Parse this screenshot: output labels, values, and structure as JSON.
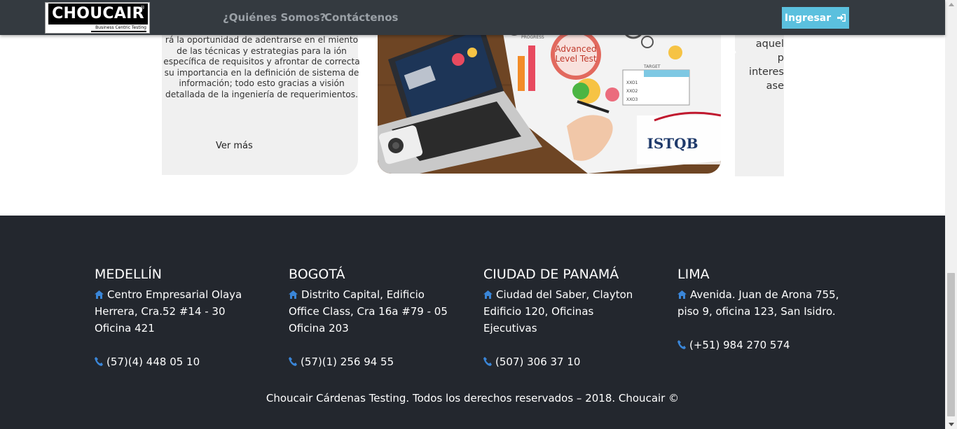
{
  "navbar": {
    "logo_text": "CHOUCAIR",
    "logo_reg": "®",
    "logo_sub": "Business Centric Testing",
    "links": [
      "¿Quiénes Somos?",
      "Contáctenos"
    ],
    "login_label": "Ingresar"
  },
  "carousel": {
    "left_text": "rá la oportunidad de adentrarse en el miento de las técnicas y estrategias para la ión específica de requisitos y afrontar de correcta su importancia en la definición de sistema de información; todo esto gracias a visión detallada de la ingeniería de requerimientos.",
    "left_more": "Ver más",
    "image_labels": {
      "advanced": "Advanced",
      "level": "Level Test",
      "progress": "PROGRESS",
      "target": "TARGET",
      "istqb": "ISTQB",
      "x1": "XXO1",
      "x2": "XXO2",
      "x3": "XXO3"
    },
    "right_lines": [
      "aquel",
      "p",
      "interes",
      "ase"
    ]
  },
  "footer": {
    "columns": [
      {
        "city": "MEDELLÍN",
        "address": "Centro Empresarial Olaya Herrera, Cra.52 #14 - 30 Oficina 421",
        "phone": "(57)(4) 448 05 10"
      },
      {
        "city": "BOGOTÁ",
        "address": "Distrito Capital, Edificio Office Class, Cra 16a #79 - 05 Oficina 203",
        "phone": "(57)(1) 256 94 55"
      },
      {
        "city": "CIUDAD DE PANAMÁ",
        "address": "Ciudad del Saber, Clayton Edificio 120, Oficinas Ejecutivas",
        "phone": "(507) 306 37 10"
      },
      {
        "city": "LIMA",
        "address": "Avenida. Juan de Arona 755, piso 9, oficina 123, San Isidro.",
        "phone": "(+51) 984 270 574"
      }
    ],
    "copyright": "Choucair Cárdenas Testing. Todos los derechos reservados – 2018. Choucair ©"
  },
  "colors": {
    "navbar": "#343a40",
    "footer": "#23272e",
    "button": "#5bc0de",
    "icon_blue": "#3a86d8"
  }
}
